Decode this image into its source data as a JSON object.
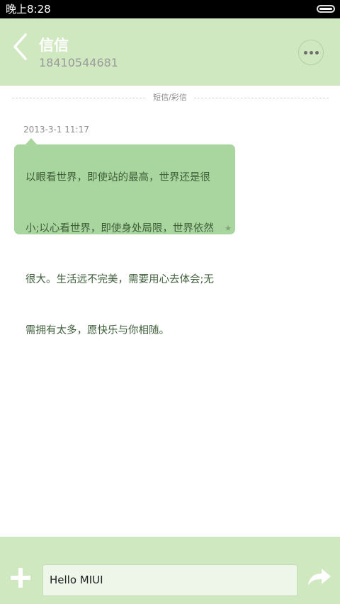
{
  "status_bar": {
    "time": "晚上8:28",
    "battery_icon": "battery-icon"
  },
  "header": {
    "contact_name": "信信",
    "contact_number": "18410544681",
    "back_icon": "chevron-left-icon",
    "more_icon": "more-dots-icon"
  },
  "conversation": {
    "divider_label": "短信/彩信",
    "messages": [
      {
        "timestamp": "2013-3-1 11:17",
        "lines": [
          "以眼看世界，即使站的最高，世界还是很",
          "小;以心看世界，即使身处局限，世界依然",
          "很大。生活远不完美，需要用心去体会;无",
          "需拥有太多，愿快乐与你相随。"
        ],
        "star_icon": "star-icon",
        "starred": true
      }
    ]
  },
  "composer": {
    "add_icon": "plus-icon",
    "input_value": "Hello MIUI",
    "send_icon": "send-arrow-icon"
  },
  "colors": {
    "status_bar_bg": "#000000",
    "header_bg": "#cfe8bf",
    "bubble_bg": "#a9d59e",
    "composer_bg": "#cfe8bf",
    "input_bg": "#eef6e9",
    "accent_white": "#ffffff"
  }
}
